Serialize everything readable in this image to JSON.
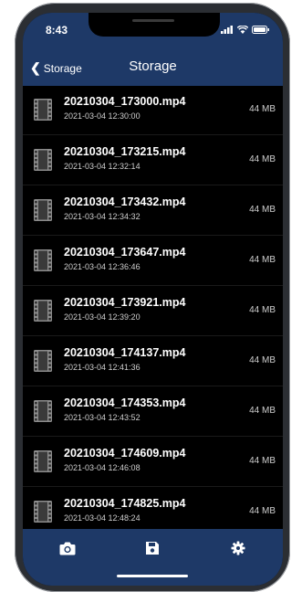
{
  "status": {
    "time": "8:43"
  },
  "nav": {
    "back_label": "Storage",
    "title": "Storage"
  },
  "files": [
    {
      "name": "20210304_173000.mp4",
      "date": "2021-03-04 12:30:00",
      "size": "44 MB"
    },
    {
      "name": "20210304_173215.mp4",
      "date": "2021-03-04 12:32:14",
      "size": "44 MB"
    },
    {
      "name": "20210304_173432.mp4",
      "date": "2021-03-04 12:34:32",
      "size": "44 MB"
    },
    {
      "name": "20210304_173647.mp4",
      "date": "2021-03-04 12:36:46",
      "size": "44 MB"
    },
    {
      "name": "20210304_173921.mp4",
      "date": "2021-03-04 12:39:20",
      "size": "44 MB"
    },
    {
      "name": "20210304_174137.mp4",
      "date": "2021-03-04 12:41:36",
      "size": "44 MB"
    },
    {
      "name": "20210304_174353.mp4",
      "date": "2021-03-04 12:43:52",
      "size": "44 MB"
    },
    {
      "name": "20210304_174609.mp4",
      "date": "2021-03-04 12:46:08",
      "size": "44 MB"
    },
    {
      "name": "20210304_174825.mp4",
      "date": "2021-03-04 12:48:24",
      "size": "44 MB"
    }
  ],
  "tabs": [
    {
      "icon": "camera-icon"
    },
    {
      "icon": "save-icon"
    },
    {
      "icon": "gear-icon"
    }
  ],
  "colors": {
    "accent": "#1e3967",
    "background": "#000000",
    "text": "#ffffff"
  }
}
